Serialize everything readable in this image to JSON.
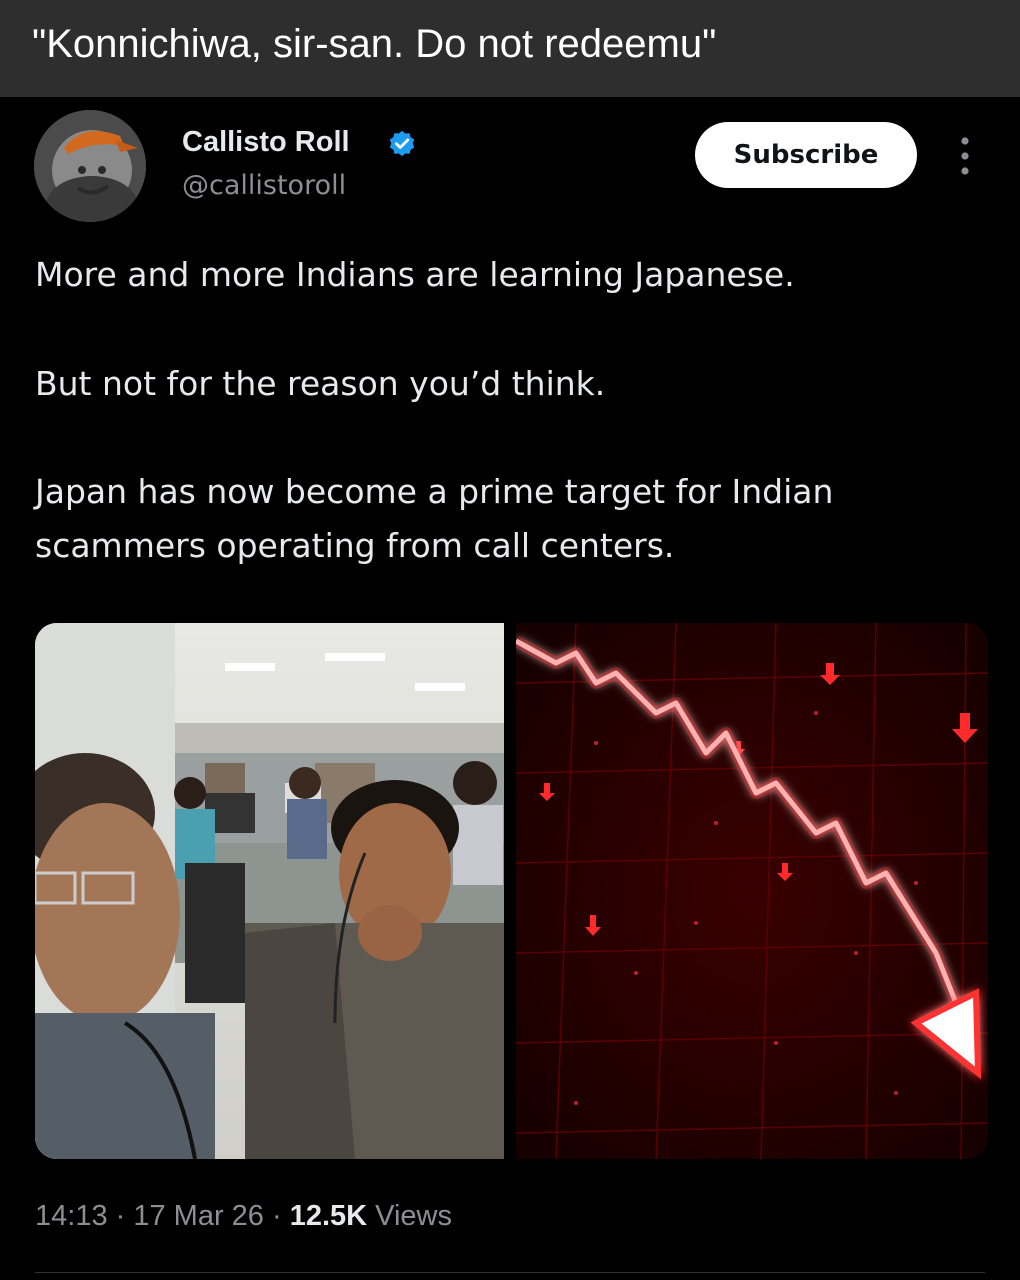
{
  "caption": {
    "text": "\"Konnichiwa, sir-san. Do not redeemu\""
  },
  "tweet": {
    "author": {
      "display_name": "Callisto Roll",
      "handle": "@callistoroll",
      "verified": true,
      "verified_color": "#1d9bf0"
    },
    "subscribe_label": "Subscribe",
    "paragraphs": [
      "More and more Indians are learning Japanese.",
      "But not for the reason you’d think.",
      "Japan has now become a prime target for Indian",
      "scammers operating from call centers."
    ],
    "timestamp": {
      "time": "14:13",
      "sep1": " · ",
      "date": "17 Mar 26",
      "sep2": " · ",
      "views": "12.5K",
      "views_label": " Views"
    }
  },
  "colors": {
    "background": "#000000",
    "caption_bar": "#2e2e2e",
    "muted_text": "#8b8f94",
    "chart_red": "#ff1a1a"
  }
}
